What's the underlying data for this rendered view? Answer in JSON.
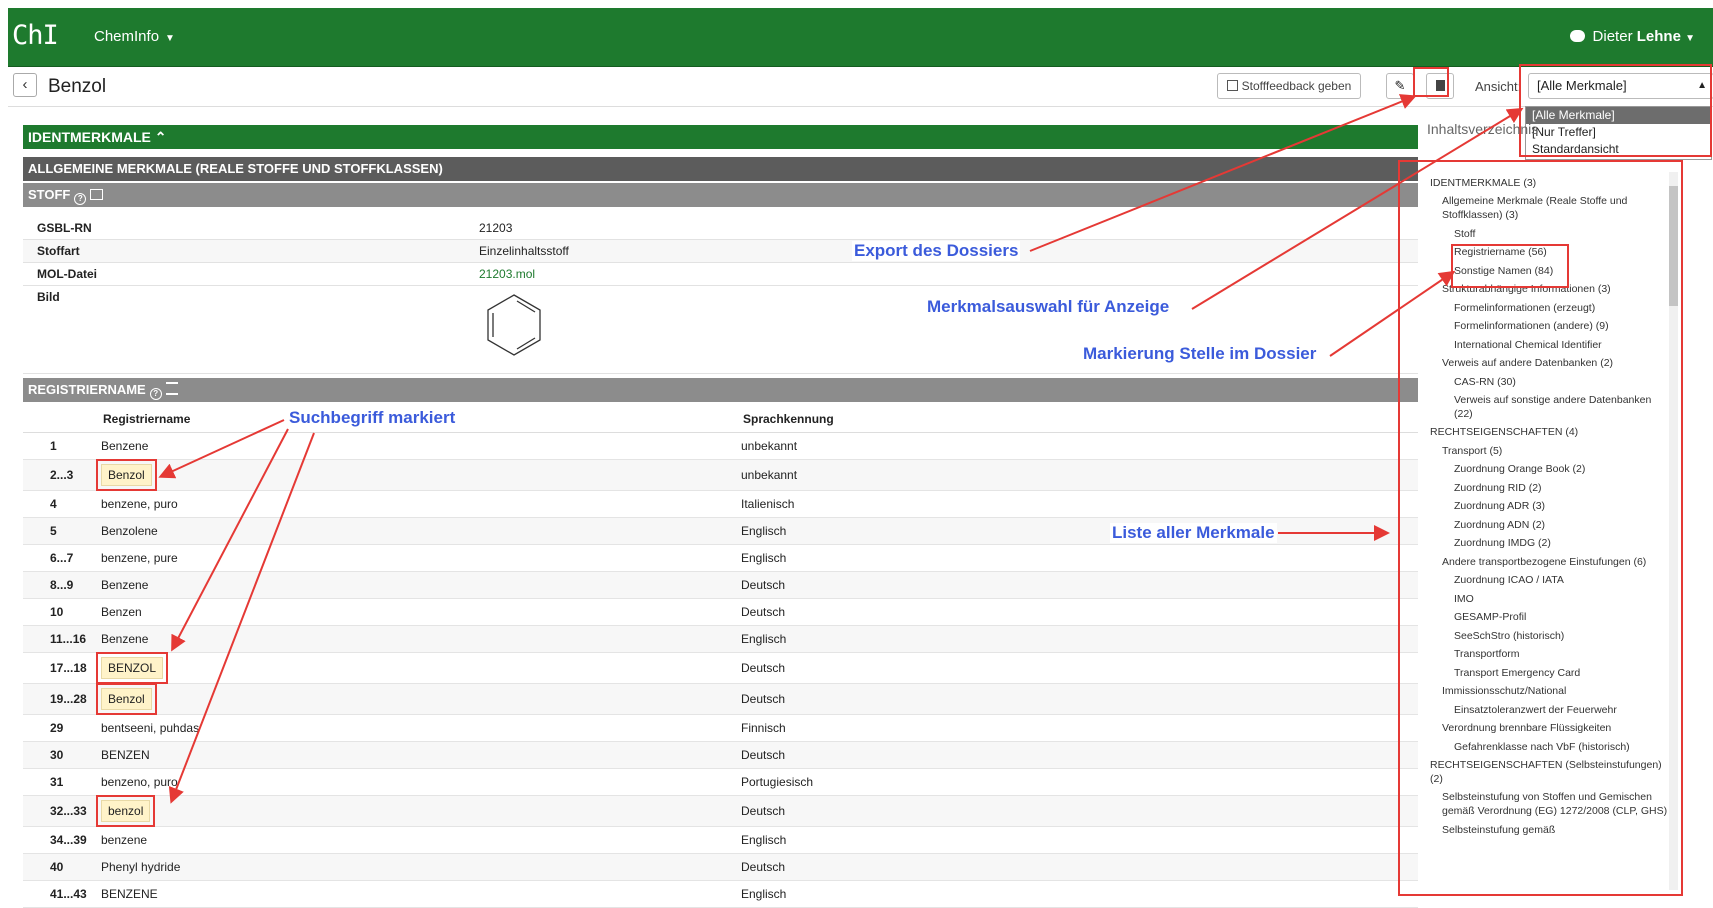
{
  "topbar": {
    "logo": "ChI",
    "app_name": "ChemInfo",
    "user_first": "Dieter",
    "user_last": "Lehne"
  },
  "titlebar": {
    "title": "Benzol",
    "feedback_label": "Stofffeedback geben",
    "ansicht_label": "Ansicht:",
    "ansicht_value": "[Alle Merkmale]",
    "ansicht_options": [
      "[Alle Merkmale]",
      "[Nur Treffer]",
      "Standardansicht"
    ]
  },
  "sections": {
    "identmerkmale": "IDENTMERKMALE",
    "allgemeine": "ALLGEMEINE MERKMALE (REALE STOFFE UND STOFFKLASSEN)",
    "stoff": "STOFF",
    "registriername": "REGISTRIERNAME"
  },
  "stoff_rows": [
    {
      "key": "GSBL-RN",
      "value": "21203"
    },
    {
      "key": "Stoffart",
      "value": "Einzelinhaltsstoff"
    },
    {
      "key": "MOL-Datei",
      "value": "21203.mol"
    },
    {
      "key": "Bild",
      "value": ""
    }
  ],
  "reg_table": {
    "headers": [
      "Registriername",
      "Sprachkennung"
    ],
    "rows": [
      {
        "num": "1",
        "name": "Benzene",
        "lang": "unbekannt"
      },
      {
        "num": "2...3",
        "name": "Benzol",
        "lang": "unbekannt"
      },
      {
        "num": "4",
        "name": "benzene, puro",
        "lang": "Italienisch"
      },
      {
        "num": "5",
        "name": "Benzolene",
        "lang": "Englisch"
      },
      {
        "num": "6...7",
        "name": "benzene, pure",
        "lang": "Englisch"
      },
      {
        "num": "8...9",
        "name": "Benzene",
        "lang": "Deutsch"
      },
      {
        "num": "10",
        "name": "Benzen",
        "lang": "Deutsch"
      },
      {
        "num": "11...16",
        "name": "Benzene",
        "lang": "Englisch"
      },
      {
        "num": "17...18",
        "name": "BENZOL",
        "lang": "Deutsch"
      },
      {
        "num": "19...28",
        "name": "Benzol",
        "lang": "Deutsch"
      },
      {
        "num": "29",
        "name": "bentseeni, puhdas",
        "lang": "Finnisch"
      },
      {
        "num": "30",
        "name": "BENZEN",
        "lang": "Deutsch"
      },
      {
        "num": "31",
        "name": "benzeno, puro",
        "lang": "Portugiesisch"
      },
      {
        "num": "32...33",
        "name": "benzol",
        "lang": "Deutsch"
      },
      {
        "num": "34...39",
        "name": "benzene",
        "lang": "Englisch"
      },
      {
        "num": "40",
        "name": "Phenyl hydride",
        "lang": "Deutsch"
      },
      {
        "num": "41...43",
        "name": "BENZENE",
        "lang": "Englisch"
      }
    ]
  },
  "toc": {
    "title": "Inhaltsverzeichnis",
    "items": [
      "IDENTMERKMALE (3)",
      "Allgemeine Merkmale (Reale Stoffe und Stoffklassen) (3)",
      "Stoff",
      "Registriername (56)",
      "Sonstige Namen (84)",
      "Strukturabhängige Informationen (3)",
      "Formelinformationen (erzeugt)",
      "Formelinformationen (andere) (9)",
      "International Chemical Identifier",
      "Verweis auf andere Datenbanken (2)",
      "CAS-RN (30)",
      "Verweis auf sonstige andere Datenbanken (22)",
      "RECHTSEIGENSCHAFTEN (4)",
      "Transport (5)",
      "Zuordnung Orange Book (2)",
      "Zuordnung RID (2)",
      "Zuordnung ADR (3)",
      "Zuordnung ADN (2)",
      "Zuordnung IMDG (2)",
      "Andere transportbezogene Einstufungen (6)",
      "Zuordnung ICAO / IATA",
      "IMO",
      "GESAMP-Profil",
      "SeeSchStro (historisch)",
      "Transportform",
      "Transport Emergency Card",
      "Immissionsschutz/National",
      "Einsatztoleranzwert der Feuerwehr",
      "Verordnung brennbare Flüssigkeiten",
      "Gefahrenklasse nach VbF (historisch)",
      "RECHTSEIGENSCHAFTEN (Selbsteinstufungen) (2)",
      "Selbsteinstufung von Stoffen und Gemischen gemäß Verordnung (EG) 1272/2008 (CLP, GHS)",
      "Selbsteinstufung gemäß"
    ]
  },
  "annotations": {
    "export": "Export des Dossiers",
    "merkmalsauswahl": "Merkmalsauswahl für Anzeige",
    "markierung": "Markierung Stelle im Dossier",
    "suchbegriff": "Suchbegriff markiert",
    "liste": "Liste aller Merkmale"
  },
  "colors": {
    "brand_green": "#1e7a2e",
    "annotation_blue": "#3b5bdb",
    "highlight_red": "#e53935"
  }
}
